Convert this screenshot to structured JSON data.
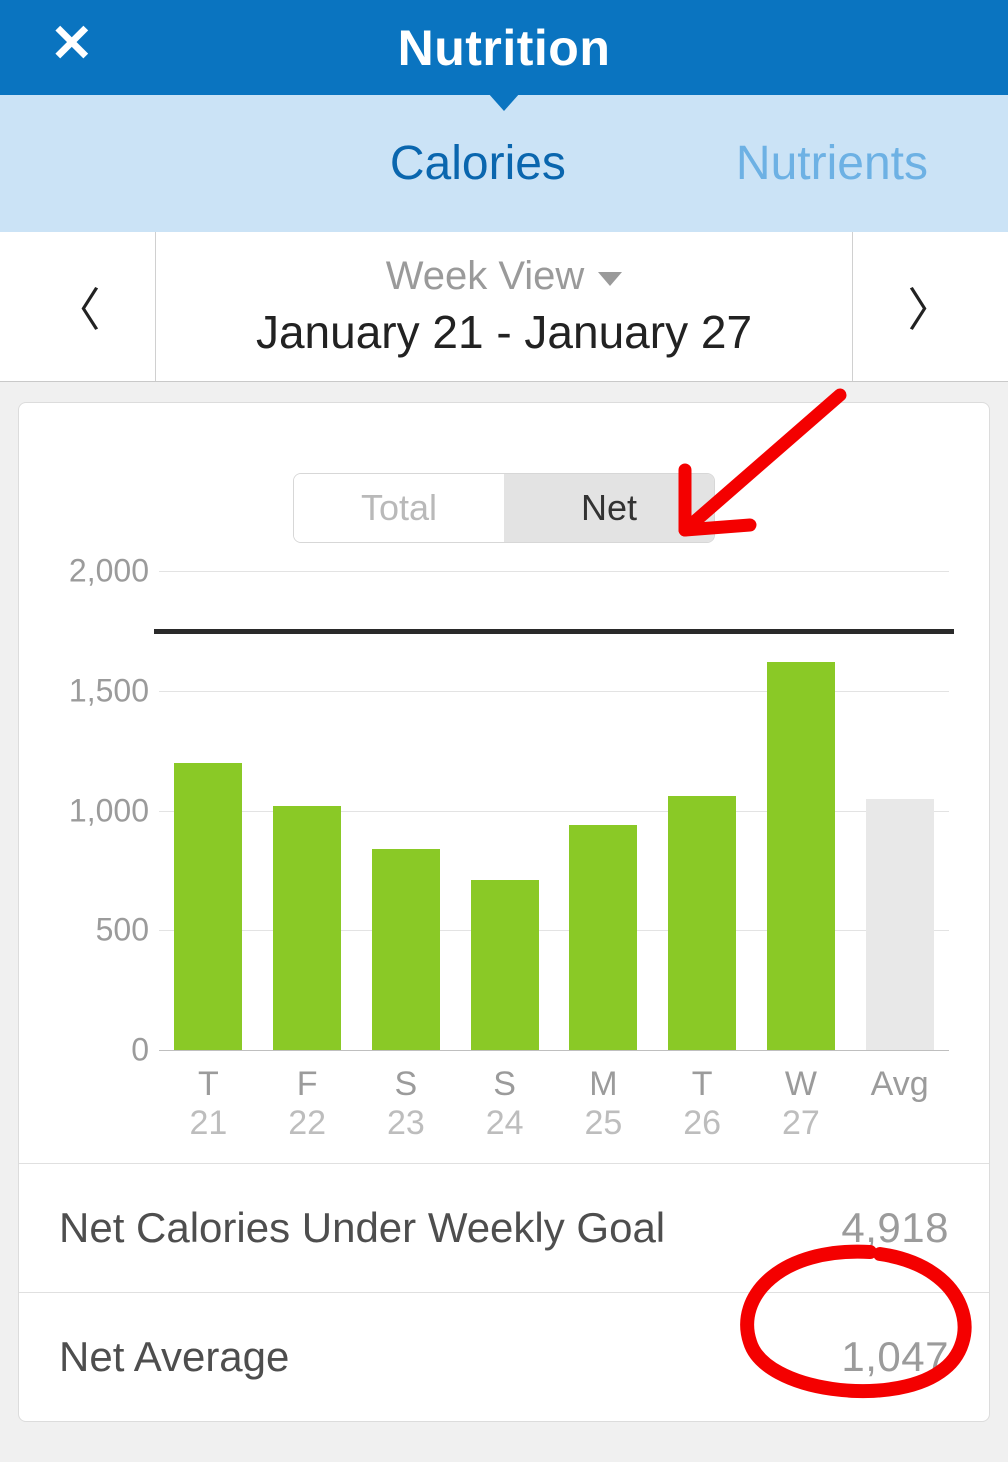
{
  "header": {
    "title": "Nutrition",
    "close_icon": "✕"
  },
  "tabs": {
    "calories": "Calories",
    "nutrients": "Nutrients",
    "active": "calories"
  },
  "datebar": {
    "view_label": "Week View",
    "range": "January 21 - January 27",
    "prev_icon": "〈",
    "next_icon": "〉"
  },
  "segment": {
    "total": "Total",
    "net": "Net",
    "selected": "net"
  },
  "stats": {
    "under_goal_label": "Net Calories Under Weekly Goal",
    "under_goal_value": "4,918",
    "net_avg_label": "Net Average",
    "net_avg_value": "1,047"
  },
  "chart_data": {
    "type": "bar",
    "ylabel": "",
    "ylim": [
      0,
      2000
    ],
    "yticks": [
      0,
      500,
      1000,
      1500,
      2000
    ],
    "ytick_labels": [
      "0",
      "500",
      "1,000",
      "1,500",
      "2,000"
    ],
    "goal_line": 1750,
    "categories": [
      "T",
      "F",
      "S",
      "S",
      "M",
      "T",
      "W",
      "Avg"
    ],
    "sub_categories": [
      "21",
      "22",
      "23",
      "24",
      "25",
      "26",
      "27",
      ""
    ],
    "series": [
      {
        "name": "Net",
        "values": [
          1200,
          1020,
          840,
          710,
          940,
          1060,
          1620,
          1047
        ],
        "colors": [
          "#8ac926",
          "#8ac926",
          "#8ac926",
          "#8ac926",
          "#8ac926",
          "#8ac926",
          "#8ac926",
          "#e8e8e8"
        ]
      }
    ]
  },
  "colors": {
    "brand": "#0a74c0",
    "bar": "#8ac926",
    "annotation": "#f40000"
  }
}
